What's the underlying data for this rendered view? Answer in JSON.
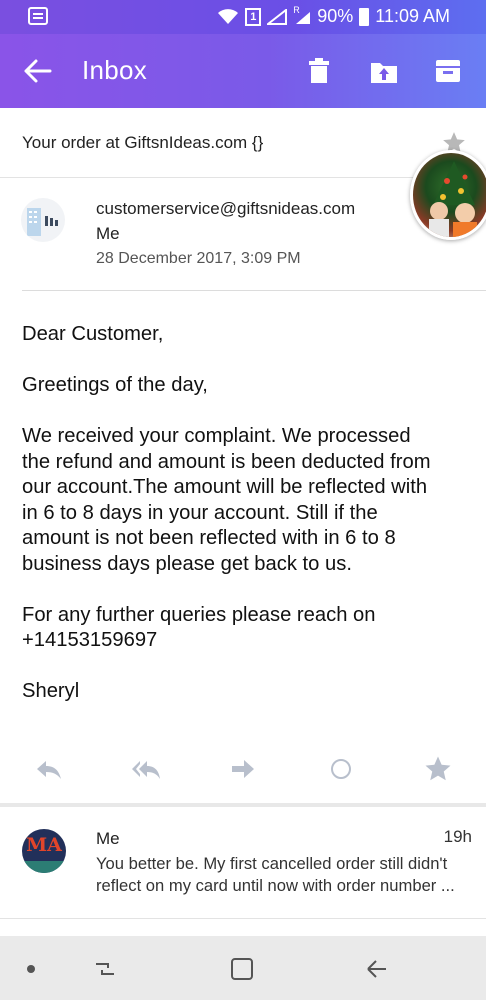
{
  "status_bar": {
    "sim_label": "1",
    "roaming_label": "R",
    "battery": "90%",
    "time": "11:09 AM"
  },
  "app_bar": {
    "title": "Inbox",
    "background_colors": [
      "#8a54e8",
      "#6a7ef4"
    ]
  },
  "email": {
    "subject": "Your order at GiftsnIdeas.com {}",
    "sender": "customerservice@giftsnideas.com",
    "recipient": "Me",
    "date": "28 December 2017, 3:09 PM",
    "body": [
      "Dear Customer,",
      "Greetings of the day,",
      "We received your complaint. We processed\nthe refund and amount is been deducted from\nour account.The amount will be reflected with\nin 6 to 8 days in your account. Still if the\namount is not been reflected with in 6 to 8\nbusiness days please get back to us.",
      "For any further queries please reach on\n+14153159697",
      "Sheryl"
    ]
  },
  "reply": {
    "avatar_text": "MA",
    "from": "Me",
    "time": "19h",
    "snippet_line1": "You better be. My first cancelled order still didn't",
    "snippet_line2": "reflect on my card until now with order number ..."
  },
  "icons": {
    "back": "arrow-left-icon",
    "delete": "trash-icon",
    "move": "folder-upload-icon",
    "archive": "archive-icon",
    "reply": "reply-icon",
    "reply_all": "reply-all-icon",
    "forward": "forward-icon",
    "unread": "circle-icon",
    "star": "star-icon"
  }
}
